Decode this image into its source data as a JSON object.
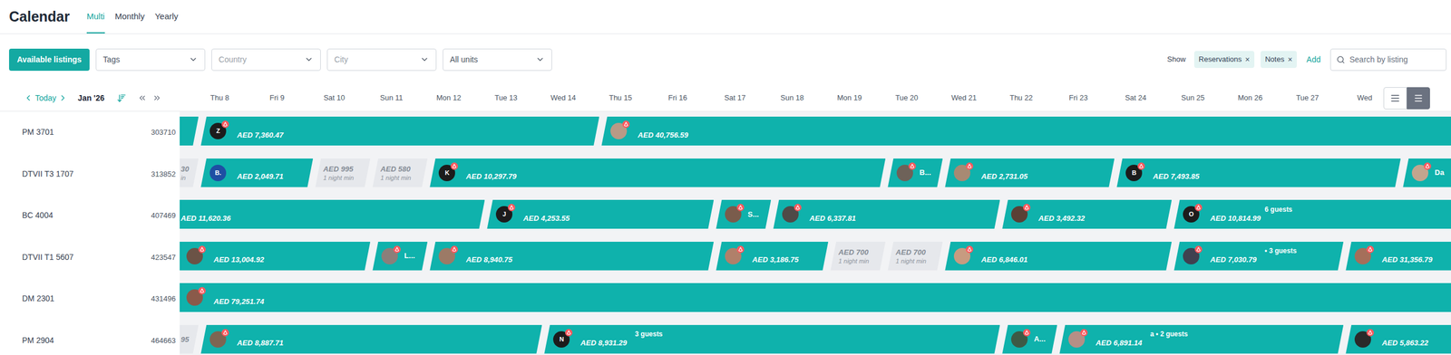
{
  "page": {
    "title": "Calendar"
  },
  "view_tabs": [
    {
      "label": "Multi",
      "selected": true
    },
    {
      "label": "Monthly",
      "selected": false
    },
    {
      "label": "Yearly",
      "selected": false
    }
  ],
  "filters": {
    "button": "Available listings",
    "dropdowns": [
      {
        "label": "Tags",
        "muted": false
      },
      {
        "label": "Country",
        "muted": true
      },
      {
        "label": "City",
        "muted": true
      },
      {
        "label": "All units",
        "muted": false
      }
    ]
  },
  "show": {
    "label": "Show",
    "chips": [
      {
        "label": "Reservations",
        "remove": "×"
      },
      {
        "label": "Notes",
        "remove": "×"
      }
    ],
    "add": "Add"
  },
  "search": {
    "placeholder": "Search by listing"
  },
  "navigator": {
    "today": "Today",
    "month": "Jan '26"
  },
  "view_toggle": [
    {
      "kind": "compact",
      "selected": false
    },
    {
      "kind": "list",
      "selected": true
    }
  ],
  "days": [
    "Thu 8",
    "Fri 9",
    "Sat 10",
    "Sun 11",
    "Mon 12",
    "Tue 13",
    "Wed 14",
    "Thu 15",
    "Fri 16",
    "Sat 17",
    "Sun 18",
    "Mon 19",
    "Tue 20",
    "Wed 21",
    "Thu 22",
    "Fri 23",
    "Sat 24",
    "Sun 25",
    "Mon 26",
    "Tue 27",
    "Wed"
  ],
  "listings": [
    {
      "name": "PM 3701",
      "id": "303710",
      "bookings": [
        {
          "kind": "reservation",
          "check_in": 6,
          "check_out": 8
        },
        {
          "kind": "reservation",
          "check_in": 8,
          "check_out": 15,
          "avatar": {
            "kind": "initial",
            "text": "Z",
            "color": "#1c1c1c",
            "badge": true
          },
          "amount": "AED 7,360.47"
        },
        {
          "kind": "reservation",
          "check_in": 15,
          "check_out": 31,
          "avatar": {
            "kind": "photo",
            "color": "#b89a86",
            "badge": true
          },
          "amount": "AED 40,756.59"
        }
      ]
    },
    {
      "name": "DTVII T3 1707",
      "id": "313852",
      "bookings": [
        {
          "kind": "price",
          "check_in": 7,
          "check_out": 8,
          "price": "30",
          "note": "in"
        },
        {
          "kind": "reservation",
          "check_in": 8,
          "check_out": 10,
          "avatar": {
            "kind": "initial",
            "text": "B.",
            "color": "#1e4fa3",
            "badge": false
          },
          "amount": "AED 2,049.71"
        },
        {
          "kind": "price",
          "check_in": 10,
          "check_out": 11,
          "price": "AED 995",
          "note": "1 night min"
        },
        {
          "kind": "price",
          "check_in": 11,
          "check_out": 12,
          "price": "AED 580",
          "note": "1 night min"
        },
        {
          "kind": "reservation",
          "check_in": 12,
          "check_out": 20,
          "avatar": {
            "kind": "initial",
            "text": "K",
            "color": "#1c1c1c",
            "badge": true
          },
          "amount": "AED 10,297.79"
        },
        {
          "kind": "reservation",
          "check_in": 20,
          "check_out": 21,
          "avatar": {
            "kind": "photo",
            "color": "#6e6259",
            "badge": true
          },
          "name": "B..."
        },
        {
          "kind": "reservation",
          "check_in": 21,
          "check_out": 24,
          "avatar": {
            "kind": "photo",
            "color": "#a88a73",
            "badge": true
          },
          "amount": "AED 2,731.05"
        },
        {
          "kind": "reservation",
          "check_in": 24,
          "check_out": 29,
          "avatar": {
            "kind": "initial",
            "text": "B",
            "color": "#1c1c1c",
            "badge": true
          },
          "amount": "AED 7,493.85"
        },
        {
          "kind": "reservation",
          "check_in": 29,
          "check_out": 32,
          "avatar": {
            "kind": "photo",
            "color": "#c2a58e",
            "badge": true
          },
          "name": "Da"
        }
      ]
    },
    {
      "name": "BC 4004",
      "id": "407469",
      "bookings": [
        {
          "kind": "reservation",
          "check_in": 5,
          "check_out": 13,
          "amount": "AED 11,620.36"
        },
        {
          "kind": "reservation",
          "check_in": 13,
          "check_out": 17,
          "avatar": {
            "kind": "initial",
            "text": "J",
            "color": "#1c1c1c",
            "badge": true
          },
          "amount": "AED 4,253.55"
        },
        {
          "kind": "reservation",
          "check_in": 17,
          "check_out": 18,
          "avatar": {
            "kind": "photo",
            "color": "#7a5c4c",
            "badge": true
          },
          "name": "S..."
        },
        {
          "kind": "reservation",
          "check_in": 18,
          "check_out": 22,
          "avatar": {
            "kind": "photo",
            "color": "#4f4a48",
            "badge": true
          },
          "amount": "AED 6,337.81"
        },
        {
          "kind": "reservation",
          "check_in": 22,
          "check_out": 25,
          "avatar": {
            "kind": "photo",
            "color": "#5a4036",
            "badge": true
          },
          "amount": "AED 3,492.32"
        },
        {
          "kind": "reservation",
          "check_in": 25,
          "check_out": 31,
          "avatar": {
            "kind": "initial",
            "text": "O",
            "color": "#1c1c1c",
            "badge": true
          },
          "label": "6 guests",
          "amount": "AED 10,814.99"
        }
      ]
    },
    {
      "name": "DTVII T1 5607",
      "id": "423547",
      "bookings": [
        {
          "kind": "reservation",
          "check_in": 5,
          "check_out": 11,
          "avatar": {
            "kind": "photo",
            "color": "#6b5346",
            "badge": true
          },
          "amount": "AED 13,004.92"
        },
        {
          "kind": "reservation",
          "check_in": 11,
          "check_out": 12,
          "avatar": {
            "kind": "photo",
            "color": "#8b7f7a",
            "badge": true
          },
          "name": "L..."
        },
        {
          "kind": "reservation",
          "check_in": 12,
          "check_out": 17,
          "avatar": {
            "kind": "photo",
            "color": "#9c7a66",
            "badge": true
          },
          "amount": "AED 8,940.75"
        },
        {
          "kind": "reservation",
          "check_in": 17,
          "check_out": 19,
          "avatar": {
            "kind": "photo",
            "color": "#b0806a",
            "badge": true
          },
          "amount": "AED 3,186.75"
        },
        {
          "kind": "price",
          "check_in": 19,
          "check_out": 20,
          "price": "AED 700",
          "note": "1 night min"
        },
        {
          "kind": "price",
          "check_in": 20,
          "check_out": 21,
          "price": "AED 700",
          "note": "1 night min"
        },
        {
          "kind": "reservation",
          "check_in": 21,
          "check_out": 25,
          "avatar": {
            "kind": "photo",
            "color": "#c79b80",
            "badge": true
          },
          "amount": "AED 6,846.01"
        },
        {
          "kind": "reservation",
          "check_in": 25,
          "check_out": 28,
          "avatar": {
            "kind": "photo",
            "color": "#3f4150",
            "badge": true
          },
          "label": "• 3 guests",
          "amount": "AED 7,030.79"
        },
        {
          "kind": "reservation",
          "check_in": 28,
          "check_out": 31,
          "avatar": {
            "kind": "photo",
            "color": "#a56f5a",
            "badge": true
          },
          "amount": "AED 31,356.79"
        }
      ]
    },
    {
      "name": "DM 2301",
      "id": "431496",
      "bookings": [
        {
          "kind": "reservation",
          "check_in": 3,
          "check_out": 31,
          "avatar": {
            "kind": "photo",
            "color": "#8a5a4a",
            "badge": true
          },
          "amount": "AED 79,251.74"
        }
      ]
    },
    {
      "name": "PM 2904",
      "id": "464663",
      "bookings": [
        {
          "kind": "price",
          "check_in": 7,
          "check_out": 8,
          "price": "95"
        },
        {
          "kind": "reservation",
          "check_in": 8,
          "check_out": 14,
          "avatar": {
            "kind": "photo",
            "color": "#7d6552",
            "badge": true
          },
          "amount": "AED 8,887.71"
        },
        {
          "kind": "reservation",
          "check_in": 14,
          "check_out": 22,
          "avatar": {
            "kind": "initial",
            "text": "N",
            "color": "#1c1c1c",
            "badge": true
          },
          "label": "3 guests",
          "amount": "AED 8,931.29"
        },
        {
          "kind": "reservation",
          "check_in": 22,
          "check_out": 23,
          "avatar": {
            "kind": "photo",
            "color": "#3d5a45",
            "badge": true
          },
          "name": "A..."
        },
        {
          "kind": "reservation",
          "check_in": 23,
          "check_out": 28,
          "avatar": {
            "kind": "photo",
            "color": "#b58f86",
            "badge": true
          },
          "label": "a • 2 guests",
          "amount": "AED 6,891.14"
        },
        {
          "kind": "reservation",
          "check_in": 28,
          "check_out": 31,
          "avatar": {
            "kind": "photo",
            "color": "#2a2a2a",
            "badge": true
          },
          "amount": "AED 5,863.22"
        }
      ]
    }
  ]
}
